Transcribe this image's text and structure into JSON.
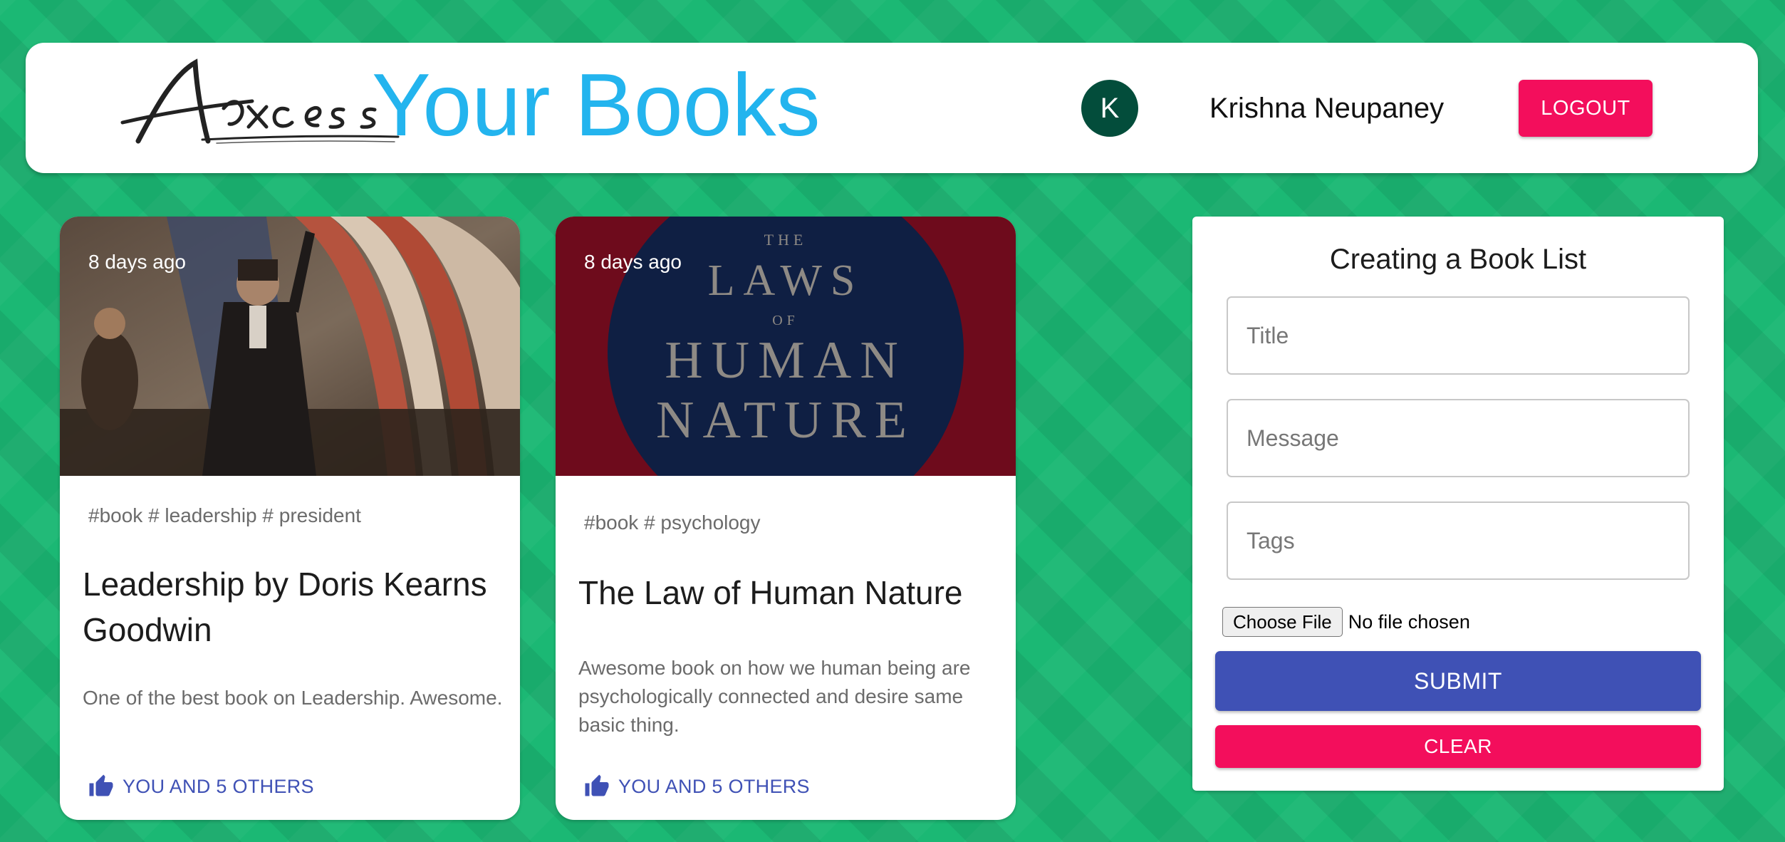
{
  "header": {
    "brand_script": "Axcess",
    "brand_title": "Your Books",
    "avatar_initial": "K",
    "username": "Krishna Neupaney",
    "logout_label": "LOGOUT"
  },
  "posts": [
    {
      "timestamp": "8 days ago",
      "image": "lincoln-painting",
      "tags": "#book # leadership # president",
      "title": "Leadership by Doris Kearns Goodwin",
      "message": "One of the best book on Leadership. Awesome.",
      "likes_label": "YOU AND 5 OTHERS"
    },
    {
      "timestamp": "8 days ago",
      "image": "book-cover",
      "cover": {
        "line1": "THE",
        "line2": "LAWS",
        "line3": "OF",
        "line4": "HUMAN",
        "line5": "NATURE"
      },
      "tags": "#book # psychology",
      "title": "The Law of Human Nature",
      "message": "Awesome book on how we human being are psychologically connected and desire same basic thing.",
      "likes_label": "YOU AND 5 OTHERS"
    }
  ],
  "form": {
    "heading": "Creating a Book List",
    "title_placeholder": "Title",
    "message_placeholder": "Message",
    "tags_placeholder": "Tags",
    "file_button": "Choose File",
    "file_status": "No file chosen",
    "submit_label": "SUBMIT",
    "clear_label": "CLEAR"
  },
  "colors": {
    "background": "#1bb874",
    "brand_blue": "#23b4ee",
    "accent_pink": "#f30e5c",
    "primary": "#3f51b5",
    "avatar": "#034d3b"
  },
  "icons": {
    "like": "thumb-up-icon"
  }
}
